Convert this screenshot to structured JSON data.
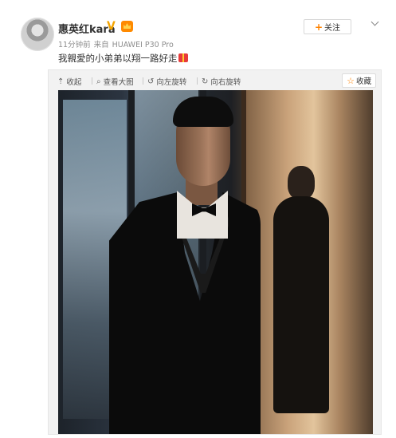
{
  "post": {
    "username": "惠英红kara",
    "verified_icon": "verified-v-icon",
    "vip_icon": "vip-crown-icon",
    "time": "11分钟前",
    "source_prefix": "来自",
    "device": "HUAWEI P30 Pro",
    "text": "我親愛的小弟弟以翔一路好走",
    "text_emoji": "gift-emoji-icon",
    "follow_plus": "+",
    "follow_label": "关注",
    "more_icon": "chevron-down-icon"
  },
  "media_toolbar": {
    "collapse_icon": "⇡",
    "collapse_label": "收起",
    "view_large_icon": "⌕",
    "view_large_label": "查看大图",
    "rotate_left_icon": "↺",
    "rotate_left_label": "向左旋转",
    "rotate_right_icon": "↻",
    "rotate_right_label": "向右旋转",
    "collect_icon": "☆",
    "collect_label": "收藏"
  },
  "colors": {
    "accent_orange": "#ff8200",
    "verified_gold": "#f4a400",
    "meta_grey": "#8e8e8e"
  }
}
